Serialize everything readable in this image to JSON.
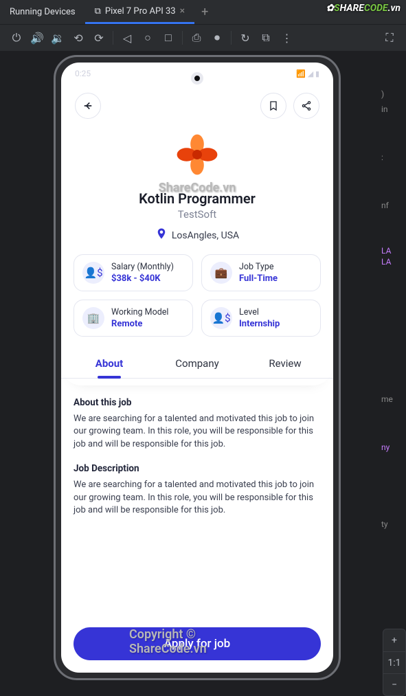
{
  "ide": {
    "tabs": [
      "Running Devices",
      "Pixel 7 Pro API 33"
    ],
    "active_tab_index": 1
  },
  "watermarks": {
    "logo": "ShareCode.vn",
    "center": "ShareCode.vn",
    "copyright": "Copyright © ShareCode.vn"
  },
  "gutter": {
    "a": ")",
    "b": "in",
    "c": ":",
    "d": "nf",
    "e": "LA",
    "f": "LA",
    "g": "me",
    "h": "ny",
    "i": "ty"
  },
  "zoom": {
    "plus": "+",
    "one": "1:1",
    "minus": "−"
  },
  "statusbar": {
    "time": "0:25"
  },
  "job": {
    "title": "Kotlin Programmer",
    "company": "TestSoft",
    "location": "LosAngles, USA",
    "salary_label": "Salary (Monthly)",
    "salary_value": "$38k - $40K",
    "type_label": "Job Type",
    "type_value": "Full-Time",
    "model_label": "Working Model",
    "model_value": "Remote",
    "level_label": "Level",
    "level_value": "Internship"
  },
  "tabs": [
    "About",
    "Company",
    "Review"
  ],
  "about": {
    "h1": "About this job",
    "p1": "We are searching for a talented and motivated this job to join our growing team. In this role, you will be responsible for this job and will be responsible for this job.",
    "h2": "Job Description",
    "p2": "We are searching for a talented and motivated this job to join our growing team. In this role, you will be responsible for this job and will be responsible for this job."
  },
  "cta": "Apply for job"
}
